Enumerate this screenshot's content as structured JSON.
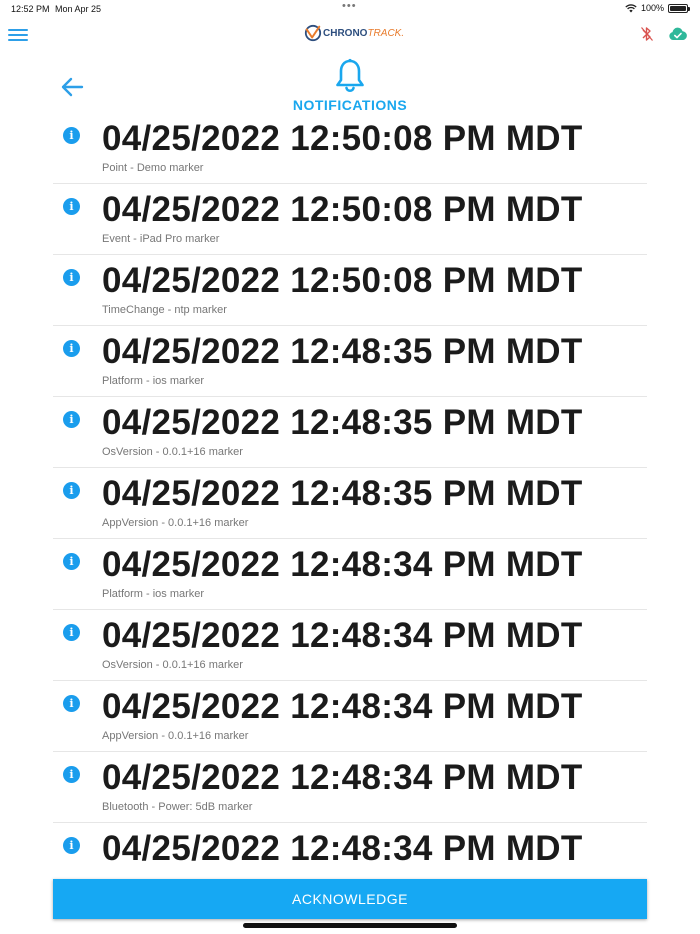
{
  "status_bar": {
    "time": "12:52 PM",
    "date": "Mon Apr 25",
    "dots": "•••",
    "battery": "100%"
  },
  "app": {
    "logo_main": "CHRONO",
    "logo_accent": "TRACK.",
    "colors": {
      "accent": "#16a8f3",
      "title": "#1aa7ee",
      "bluetooth": "#d9534f",
      "cloud": "#2fb89a"
    },
    "icons": {
      "menu": "menu-icon",
      "bluetooth": "bluetooth-off-icon",
      "cloud": "cloud-check-icon",
      "back": "arrow-left-icon",
      "bell": "bell-icon",
      "info": "info-icon"
    }
  },
  "page": {
    "title": "NOTIFICATIONS"
  },
  "notifications": [
    {
      "timestamp": "04/25/2022 12:50:08 PM MDT",
      "description": "Point - Demo marker"
    },
    {
      "timestamp": "04/25/2022 12:50:08 PM MDT",
      "description": "Event - iPad Pro marker"
    },
    {
      "timestamp": "04/25/2022 12:50:08 PM MDT",
      "description": "TimeChange - ntp marker"
    },
    {
      "timestamp": "04/25/2022 12:48:35 PM MDT",
      "description": "Platform - ios marker"
    },
    {
      "timestamp": "04/25/2022 12:48:35 PM MDT",
      "description": "OsVersion - 0.0.1+16 marker"
    },
    {
      "timestamp": "04/25/2022 12:48:35 PM MDT",
      "description": "AppVersion - 0.0.1+16 marker"
    },
    {
      "timestamp": "04/25/2022 12:48:34 PM MDT",
      "description": "Platform - ios marker"
    },
    {
      "timestamp": "04/25/2022 12:48:34 PM MDT",
      "description": "OsVersion - 0.0.1+16 marker"
    },
    {
      "timestamp": "04/25/2022 12:48:34 PM MDT",
      "description": "AppVersion - 0.0.1+16 marker"
    },
    {
      "timestamp": "04/25/2022 12:48:34 PM MDT",
      "description": "Bluetooth - Power: 5dB marker"
    },
    {
      "timestamp": "04/25/2022 12:48:34 PM MDT",
      "description": ""
    }
  ],
  "footer": {
    "acknowledge_label": "ACKNOWLEDGE"
  }
}
